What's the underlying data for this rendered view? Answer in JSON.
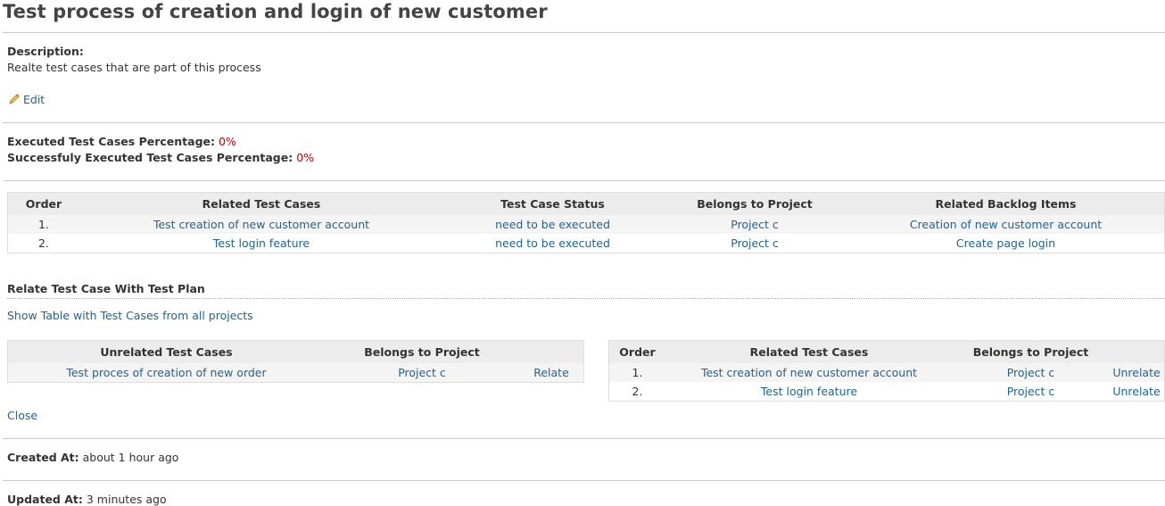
{
  "page": {
    "title": "Test process of creation and login of new customer"
  },
  "description": {
    "label": "Description:",
    "text": "Realte test cases that are part of this process",
    "edit_label": "Edit"
  },
  "stats": {
    "executed_label": "Executed Test Cases Percentage:",
    "executed_value": "0%",
    "success_label": "Successfuly Executed Test Cases Percentage:",
    "success_value": "0%"
  },
  "related_table": {
    "headers": [
      "Order",
      "Related Test Cases",
      "Test Case Status",
      "Belongs to Project",
      "Related Backlog Items"
    ],
    "rows": [
      {
        "order": "1.",
        "test_case": "Test creation of new customer account",
        "status": "need to be executed",
        "project": "Project c",
        "backlog": "Creation of new customer account"
      },
      {
        "order": "2.",
        "test_case": "Test login feature",
        "status": "need to be executed",
        "project": "Project c",
        "backlog": "Create page login"
      }
    ]
  },
  "relate_section": {
    "heading": "Relate Test Case With Test Plan",
    "show_all_label": "Show Table with Test Cases from all projects",
    "close_label": "Close"
  },
  "unrelated_table": {
    "headers": [
      "Unrelated Test Cases",
      "Belongs to Project"
    ],
    "rows": [
      {
        "test_case": "Test proces of creation of new order",
        "project": "Project c",
        "action": "Relate"
      }
    ]
  },
  "related_small_table": {
    "headers": [
      "Order",
      "Related Test Cases",
      "Belongs to Project"
    ],
    "rows": [
      {
        "order": "1.",
        "test_case": "Test creation of new customer account",
        "project": "Project c",
        "action": "Unrelate"
      },
      {
        "order": "2.",
        "test_case": "Test login feature",
        "project": "Project c",
        "action": "Unrelate"
      }
    ]
  },
  "meta": {
    "created_label": "Created At:",
    "created_value": "about 1 hour ago",
    "updated_label": "Updated At:",
    "updated_value": "3 minutes ago"
  },
  "icons": {
    "edit": "pencil-icon"
  },
  "colors": {
    "link": "#1f6397",
    "percentage": "#cc0000",
    "table_header_bg": "#ececec",
    "table_alt_row_bg": "#f4f4f4"
  }
}
